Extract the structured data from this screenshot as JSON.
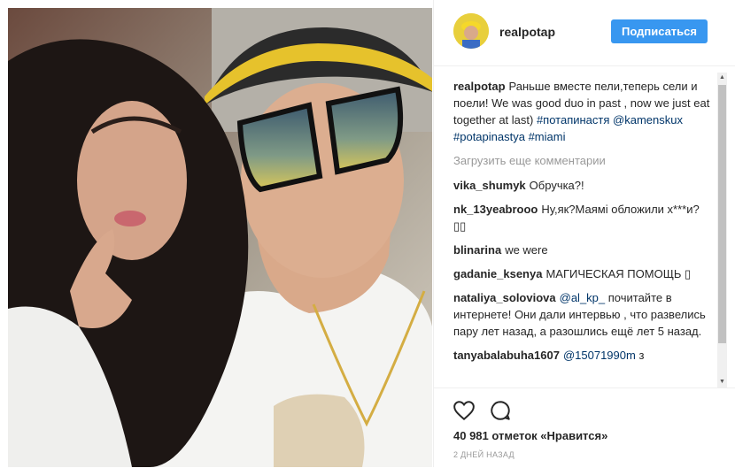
{
  "post": {
    "username": "realpotap",
    "follow_label": "Подписаться",
    "load_more_label": "Загрузить еще комментарии",
    "likes_text": "40 981 отметок «Нравится»",
    "time_text": "2 ДНЕЙ НАЗАД"
  },
  "caption": {
    "author": "realpotap",
    "text_plain": "Раньше вместе пели,теперь сели и поели! We was good duo in past , now we just eat together at last) ",
    "tags": "#потапинастя @kamenskux #potapinastya #miami"
  },
  "comments": [
    {
      "author": "vika_shumyk",
      "text": "Обручка?!"
    },
    {
      "author": "nk_13yeabrooo",
      "text": "Ну,як?Маямі обложили х***и?▯▯"
    },
    {
      "author": "blinarina",
      "text": "we were"
    },
    {
      "author": "gadanie_ksenya",
      "text": "МАГИЧЕСКАЯ ПОМОЩЬ ▯"
    },
    {
      "author": "nataliya_soloviova",
      "mention": "@al_kp_",
      "text": " почитайте в интернете! Они дали интервью , что развелись пару лет назад, а разошлись ещё лет 5 назад."
    },
    {
      "author": "tanyabalabuha1607",
      "mention": "@15071990m",
      "text": " з"
    }
  ],
  "icons": {
    "like": "heart-icon",
    "comment": "speech-bubble-icon",
    "scroll_up": "arrow-up-icon",
    "scroll_down": "arrow-down-icon"
  },
  "colors": {
    "follow_button": "#3897f0",
    "hashtag": "#003569",
    "muted": "#999999"
  }
}
